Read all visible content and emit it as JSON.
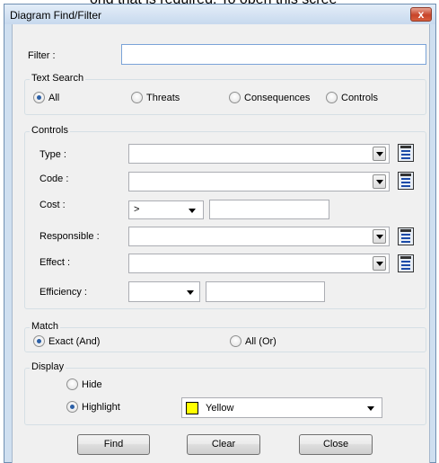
{
  "background_text": "ond that is required.  To open this scree",
  "window": {
    "title": "Diagram Find/Filter",
    "close_glyph": "x"
  },
  "filter": {
    "label": "Filter :",
    "value": ""
  },
  "text_search": {
    "label": "Text Search",
    "options": [
      "All",
      "Threats",
      "Consequences",
      "Controls"
    ],
    "selected": "All"
  },
  "controls": {
    "label": "Controls",
    "type_label": "Type :",
    "code_label": "Code :",
    "cost_label": "Cost :",
    "cost_operator": ">",
    "cost_value": "",
    "responsible_label": "Responsible :",
    "effect_label": "Effect :",
    "efficiency_label": "Efficiency :",
    "efficiency_value": ""
  },
  "match": {
    "label": "Match",
    "options": [
      "Exact (And)",
      "All (Or)"
    ],
    "selected": "Exact (And)"
  },
  "display": {
    "label": "Display",
    "options": [
      "Hide",
      "Highlight"
    ],
    "selected": "Highlight",
    "color": "Yellow",
    "color_hex": "#ffff00"
  },
  "buttons": {
    "find": "Find",
    "clear": "Clear",
    "close": "Close"
  }
}
